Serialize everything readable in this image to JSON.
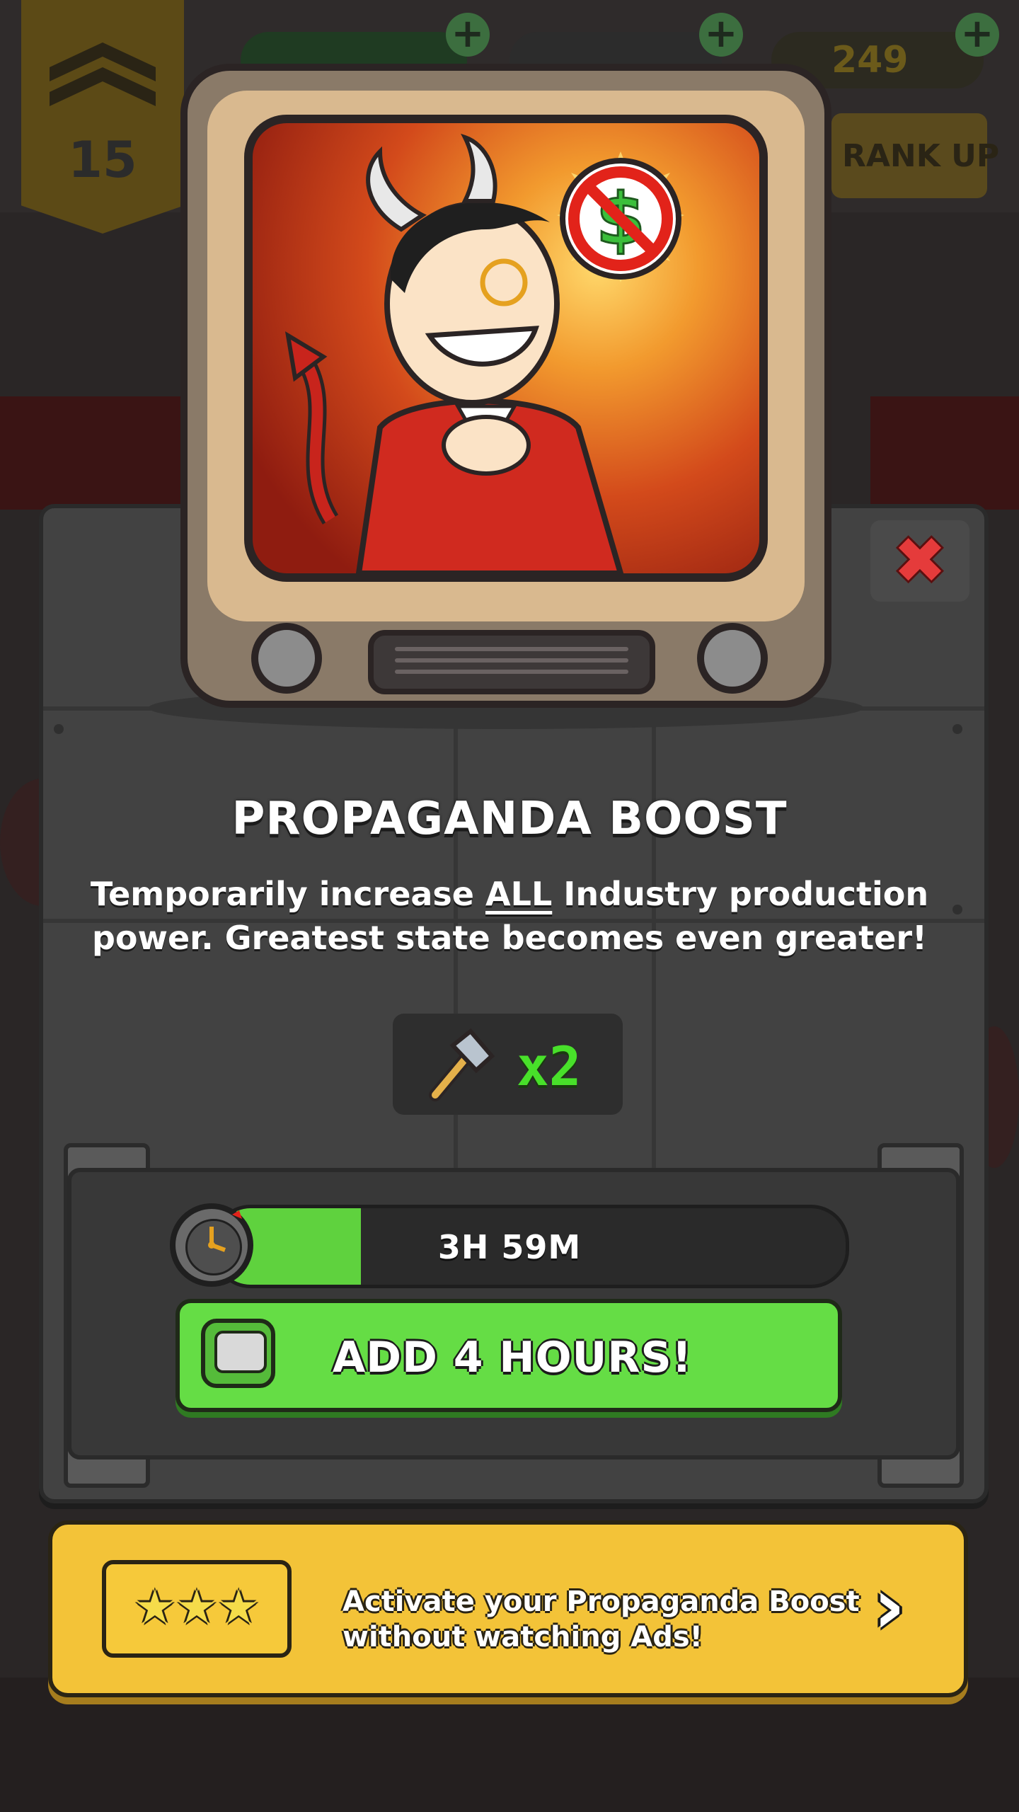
{
  "header": {
    "rank_number": "15",
    "gold_amount": "249",
    "rank_up_label": "RANK UP"
  },
  "popup": {
    "title": "PROPAGANDA BOOST",
    "description_part1": "Temporarily increase ",
    "description_emphasis": "ALL",
    "description_part2": " Industry production power. Greatest state becomes even greater!",
    "multiplier": "x2",
    "timer": {
      "remaining_label": "3H 59M",
      "progress_fraction": 0.23
    },
    "add_button_label": "ADD 4 HOURS!",
    "close_icon": "close-icon"
  },
  "premium_offer": {
    "text_line1": "Activate your Propaganda Boost",
    "text_line2": "without watching Ads!",
    "chevron": "›"
  },
  "colors": {
    "accent_green": "#65dd45",
    "close_red": "#e53b3b",
    "premium_gold": "#f3c338",
    "multiplier_green": "#48e02a"
  }
}
